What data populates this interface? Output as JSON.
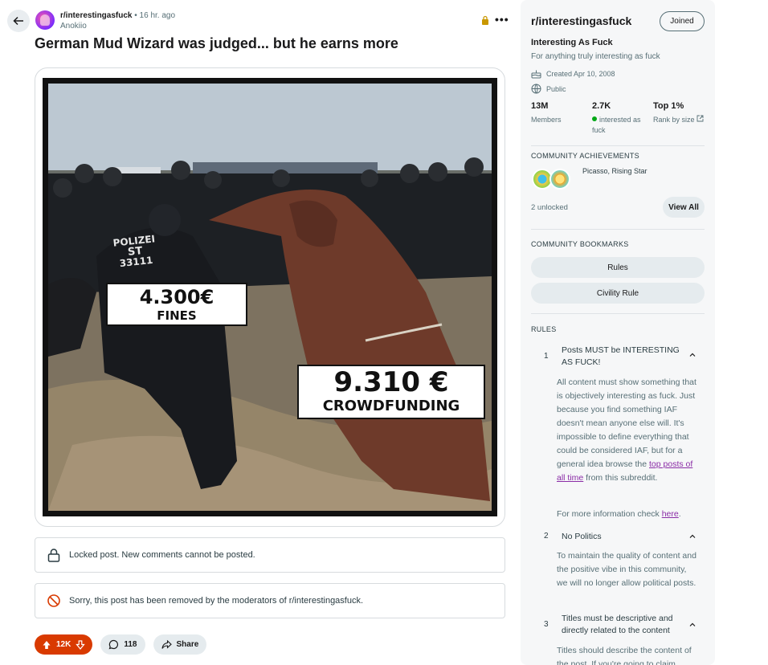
{
  "post": {
    "subreddit": "r/interestingasfuck",
    "time": "• 16 hr. ago",
    "author": "Anokiio",
    "title": "German Mud Wizard was judged... but he earns more",
    "image_labels": {
      "fines_amount": "4.300€",
      "fines_label": "FINES",
      "crowd_amount": "9.310 €",
      "crowd_label": "CROWDFUNDING",
      "vest_line1": "POLIZEI",
      "vest_line2": "ST",
      "vest_line3": "33111"
    },
    "locked_notice": "Locked post. New comments cannot be posted.",
    "removed_notice": "Sorry, this post has been removed by the moderators of r/interestingasfuck.",
    "votes": "12K",
    "comments": "118",
    "share": "Share"
  },
  "sidebar": {
    "title": "r/interestingasfuck",
    "joined": "Joined",
    "name": "Interesting As Fuck",
    "description": "For anything truly interesting as fuck",
    "created": "Created Apr 10, 2008",
    "visibility": "Public",
    "stats": [
      {
        "value": "13M",
        "label": "Members"
      },
      {
        "value": "2.7K",
        "label": "interested as fuck"
      },
      {
        "value": "Top 1%",
        "label": "Rank by size"
      }
    ],
    "achievements_title": "COMMUNITY ACHIEVEMENTS",
    "achievements_names": "Picasso, Rising Star",
    "unlocked": "2 unlocked",
    "view_all": "View All",
    "bookmarks_title": "COMMUNITY BOOKMARKS",
    "bookmarks": [
      "Rules",
      "Civility Rule"
    ],
    "rules_title": "RULES",
    "rules": [
      {
        "num": "1",
        "title": "Posts MUST be INTERESTING AS FUCK!",
        "body_pre": "All content must show something that is objectively interesting as fuck. Just because you find something IAF doesn't mean anyone else will. It's impossible to define everything that could be considered IAF, but for a general idea browse the ",
        "body_link": "top posts of all time",
        "body_post": " from this subreddit.",
        "more_pre": "For more information check ",
        "more_link": "here",
        "more_post": "."
      },
      {
        "num": "2",
        "title": "No Politics",
        "body": "To maintain the quality of content and the positive vibe in this community, we will no longer allow political posts."
      },
      {
        "num": "3",
        "title": "Titles must be descriptive and directly related to the content",
        "body": "Titles should describe the content of the post. If you're going to claim"
      }
    ]
  },
  "colors": {
    "upvote": "#d93a00",
    "online": "#01a816",
    "link": "#8a2ca6",
    "lock": "#c99700"
  }
}
